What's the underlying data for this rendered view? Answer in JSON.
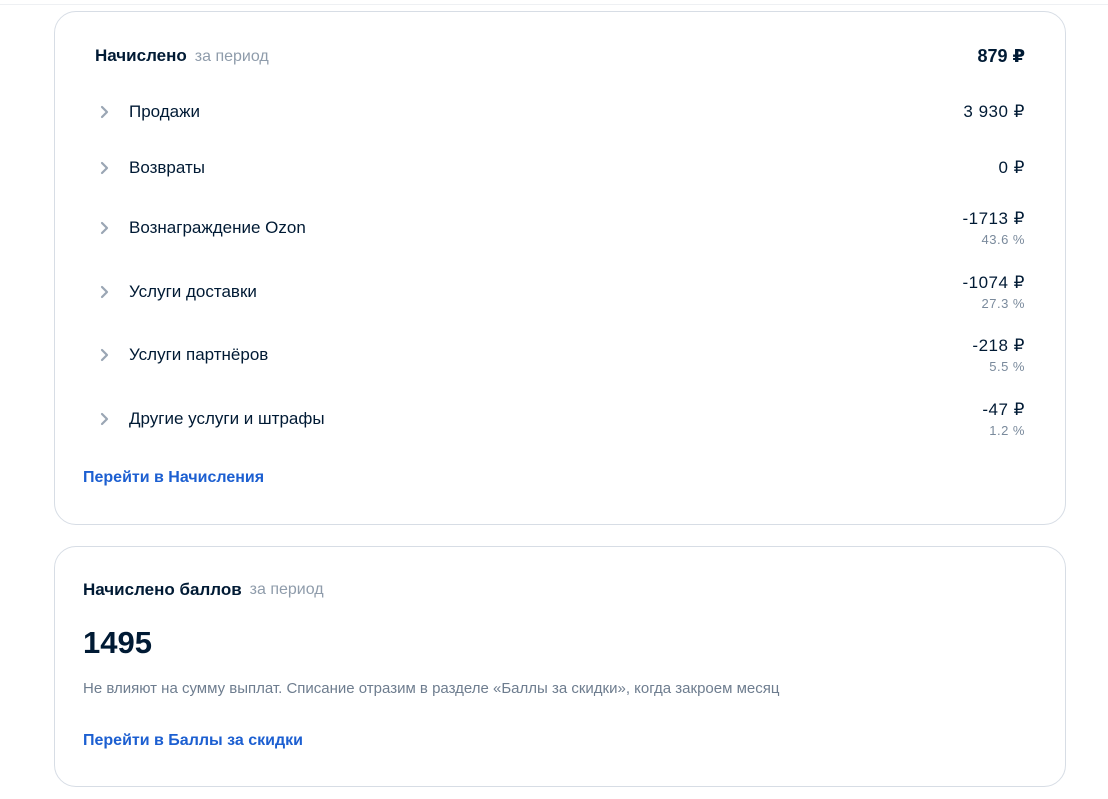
{
  "accrued": {
    "title": "Начислено",
    "subtitle": "за период",
    "total": "879 ₽",
    "rows": [
      {
        "label": "Продажи",
        "amount": "3 930 ₽",
        "percent": ""
      },
      {
        "label": "Возвраты",
        "amount": "0 ₽",
        "percent": ""
      },
      {
        "label": "Вознаграждение Ozon",
        "amount": "-1713 ₽",
        "percent": "43.6 %"
      },
      {
        "label": "Услуги доставки",
        "amount": "-1074 ₽",
        "percent": "27.3 %"
      },
      {
        "label": "Услуги партнёров",
        "amount": "-218 ₽",
        "percent": "5.5 %"
      },
      {
        "label": "Другие услуги и штрафы",
        "amount": "-47 ₽",
        "percent": "1.2 %"
      }
    ],
    "link": "Перейти в Начисления"
  },
  "points": {
    "title": "Начислено баллов",
    "subtitle": "за период",
    "value": "1495",
    "note": "Не влияют на сумму выплат. Списание отразим в разделе «Баллы за скидки», когда закроем месяц",
    "link": "Перейти в Баллы за скидки"
  },
  "colors": {
    "text": "#001a34",
    "muted": "#8f9cab",
    "link": "#1c5fd1",
    "border": "#d7dde5"
  },
  "icons": {
    "row_expand": "chevron-right-icon"
  }
}
